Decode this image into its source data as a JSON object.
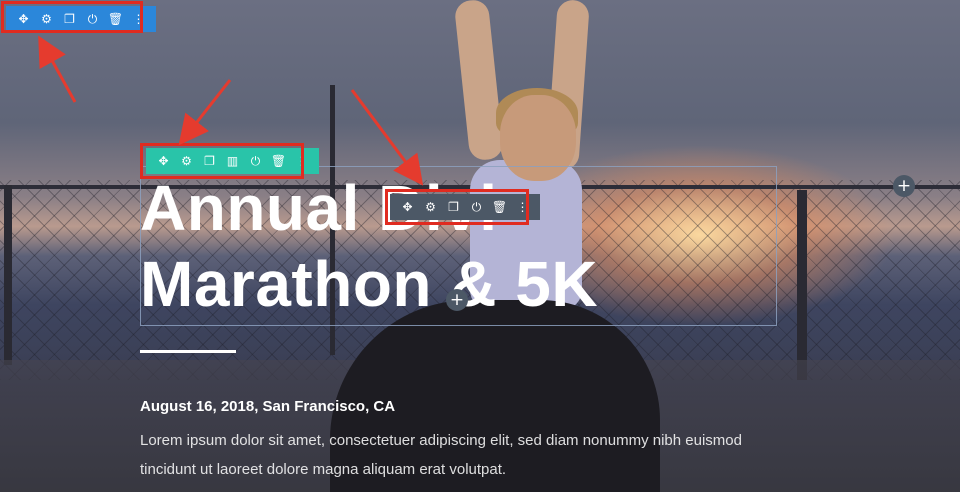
{
  "hero": {
    "title_line1": "Annual Divi",
    "title_line2": "Marathon & 5K",
    "subheading": "August 16, 2018, San Francisco, CA",
    "body": "Lorem ipsum dolor sit amet, consectetuer adipiscing elit, sed diam nonummy nibh euismod tincidunt ut laoreet dolore magna aliquam erat volutpat."
  },
  "toolbars": {
    "section": {
      "color": "#2b87da",
      "icons": [
        "move-icon",
        "settings-icon",
        "duplicate-icon",
        "save-icon",
        "delete-icon",
        "more-icon"
      ]
    },
    "row": {
      "color": "#29c4a9",
      "icons": [
        "move-icon",
        "settings-icon",
        "duplicate-icon",
        "columns-icon",
        "save-icon",
        "delete-icon",
        "more-icon"
      ]
    },
    "module": {
      "color": "#4c5866",
      "icons": [
        "move-icon",
        "settings-icon",
        "duplicate-icon",
        "save-icon",
        "delete-icon",
        "more-icon"
      ]
    }
  },
  "glyphs": {
    "move": "✥",
    "settings": "⚙",
    "duplicate": "❐",
    "columns": "▥",
    "save": "⏻",
    "delete": "🗑",
    "more": "⋮",
    "plus": "+"
  },
  "colors": {
    "annotation_red": "#e02b20",
    "module_outline": "#8ca0be"
  }
}
